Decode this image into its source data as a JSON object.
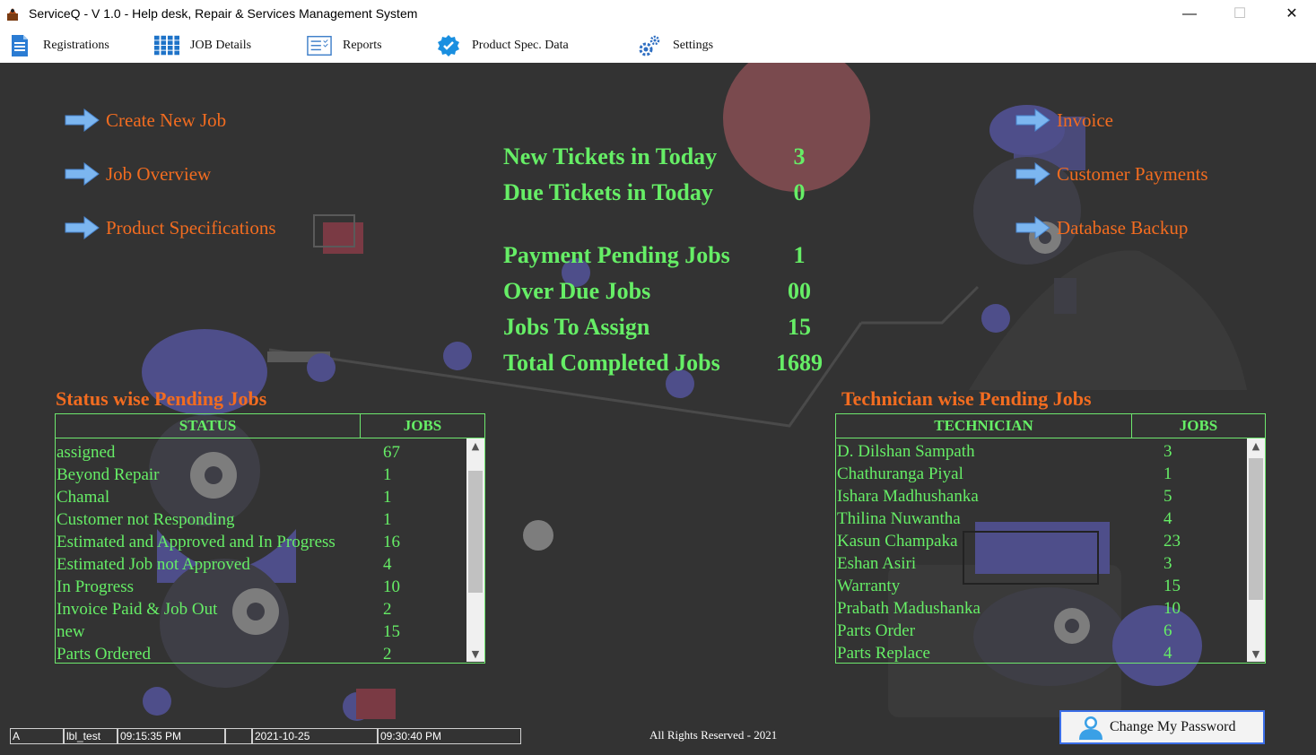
{
  "window": {
    "title": "ServiceQ - V 1.0 - Help desk, Repair & Services Management System",
    "controls": {
      "minimize": "—",
      "maximize": "☐",
      "close": "✕"
    }
  },
  "menu": [
    {
      "label": "Registrations",
      "icon": "document-icon"
    },
    {
      "label": "JOB  Details",
      "icon": "grid-icon"
    },
    {
      "label": "Reports",
      "icon": "checklist-icon"
    },
    {
      "label": "Product Spec. Data",
      "icon": "verified-badge-icon"
    },
    {
      "label": "Settings",
      "icon": "gears-icon"
    }
  ],
  "left_links": [
    "Create New Job",
    "Job Overview",
    "Product Specifications"
  ],
  "right_links": [
    "Invoice",
    "Customer Payments",
    "Database Backup"
  ],
  "stats": [
    {
      "label": "New Tickets in Today",
      "value": "3"
    },
    {
      "label": "Due Tickets in Today",
      "value": "0"
    },
    {
      "label": "Payment Pending Jobs",
      "value": "1"
    },
    {
      "label": "Over Due Jobs",
      "value": "00"
    },
    {
      "label": "Jobs To Assign",
      "value": "15"
    },
    {
      "label": "Total Completed Jobs",
      "value": "1689"
    }
  ],
  "status_grid": {
    "title": "Status wise Pending Jobs",
    "headers": [
      "STATUS",
      "JOBS"
    ],
    "rows": [
      [
        "assigned",
        "67"
      ],
      [
        "Beyond Repair",
        "1"
      ],
      [
        "Chamal",
        "1"
      ],
      [
        "Customer not Responding",
        "1"
      ],
      [
        "Estimated and Approved and In Progress",
        "16"
      ],
      [
        "Estimated Job not Approved",
        "4"
      ],
      [
        "In Progress",
        "10"
      ],
      [
        "Invoice Paid & Job Out",
        "2"
      ],
      [
        "new",
        "15"
      ],
      [
        "Parts Ordered",
        "2"
      ]
    ]
  },
  "tech_grid": {
    "title": "Technician wise Pending Jobs",
    "headers": [
      "TECHNICIAN",
      "JOBS"
    ],
    "rows": [
      [
        "D. Dilshan Sampath",
        "3"
      ],
      [
        "Chathuranga Piyal",
        "1"
      ],
      [
        "Ishara Madhushanka",
        "5"
      ],
      [
        "Thilina Nuwantha",
        "4"
      ],
      [
        "Kasun Champaka",
        "23"
      ],
      [
        "Eshan Asiri",
        "3"
      ],
      [
        "Warranty",
        "15"
      ],
      [
        "Prabath Madushanka",
        "10"
      ],
      [
        "Parts Order",
        "6"
      ],
      [
        "Parts Replace",
        "4"
      ]
    ]
  },
  "statusbar": [
    "A",
    "lbl_test",
    "09:15:35 PM",
    "",
    "2021-10-25",
    "09:30:40 PM"
  ],
  "footer": "All Rights Reserved - 2021",
  "change_password_label": "Change My Password",
  "colors": {
    "accent_orange": "#f26c20",
    "accent_green": "#66ee66",
    "background": "#333333"
  }
}
